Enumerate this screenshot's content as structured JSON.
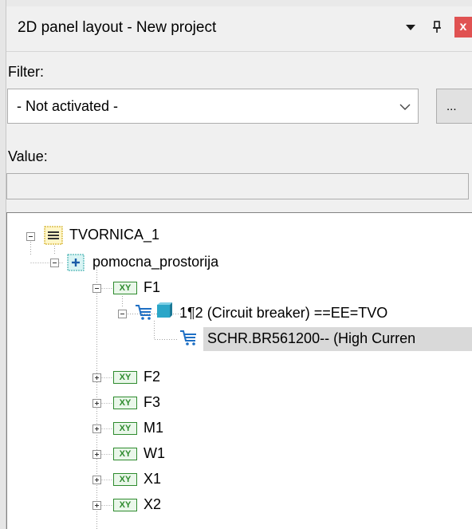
{
  "panel": {
    "title": "2D panel layout - New project",
    "close_label": "x"
  },
  "filter": {
    "label": "Filter:",
    "selected": "- Not activated -",
    "more_button": "..."
  },
  "value": {
    "label": "Value:",
    "current": ""
  },
  "tree": {
    "root": "TVORNICA_1",
    "room": "pomocna_prostorija",
    "f1": "F1",
    "device": "1¶2 (Circuit breaker) ==EE=TVO",
    "article": "SCHR.BR561200-- (High Curren",
    "siblings": [
      "F2",
      "F3",
      "M1",
      "W1",
      "X1",
      "X2"
    ],
    "xy_badge": "XY"
  },
  "colors": {
    "close_red": "#e05252",
    "tree_selection": "#d9d9d9",
    "xy_green": "#2e8b2e",
    "cart_blue": "#1e6fc4"
  }
}
